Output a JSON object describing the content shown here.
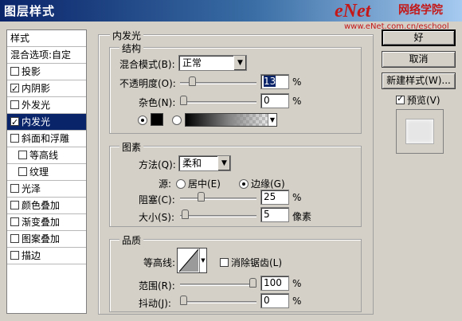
{
  "window": {
    "title": "图层样式",
    "watermark": "eNet",
    "watermark_sub": "网络学院",
    "watermark_url": "www.eNet.com.cn/eschool"
  },
  "styles_panel": {
    "header": "样式",
    "blending": "混合选项:自定",
    "items": [
      {
        "label": "投影",
        "checked": false
      },
      {
        "label": "内阴影",
        "checked": true
      },
      {
        "label": "外发光",
        "checked": false
      },
      {
        "label": "内发光",
        "checked": true,
        "selected": true
      },
      {
        "label": "斜面和浮雕",
        "checked": false
      },
      {
        "label": "等高线",
        "checked": false,
        "indent": true
      },
      {
        "label": "纹理",
        "checked": false,
        "indent": true
      },
      {
        "label": "光泽",
        "checked": false
      },
      {
        "label": "颜色叠加",
        "checked": false
      },
      {
        "label": "渐变叠加",
        "checked": false
      },
      {
        "label": "图案叠加",
        "checked": false
      },
      {
        "label": "描边",
        "checked": false
      }
    ]
  },
  "inner_glow": {
    "title": "内发光",
    "structure": {
      "title": "结构",
      "blend_mode_label": "混合模式(B):",
      "blend_mode_value": "正常",
      "opacity_label": "不透明度(O):",
      "opacity_value": "13",
      "opacity_unit": "%",
      "opacity_fraction": 0.13,
      "noise_label": "杂色(N):",
      "noise_value": "0",
      "noise_unit": "%",
      "noise_fraction": 0.0,
      "color_swatch": "#000000"
    },
    "elements": {
      "title": "图素",
      "technique_label": "方法(Q):",
      "technique_value": "柔和",
      "source_label": "源:",
      "source_center": "居中(E)",
      "source_edge": "边缘(G)",
      "choke_label": "阻塞(C):",
      "choke_value": "25",
      "choke_unit": "%",
      "choke_fraction": 0.25,
      "size_label": "大小(S):",
      "size_value": "5",
      "size_unit": "像素",
      "size_fraction": 0.02
    },
    "quality": {
      "title": "品质",
      "contour_label": "等高线:",
      "antialias_label": "消除锯齿(L)",
      "range_label": "范围(R):",
      "range_value": "100",
      "range_unit": "%",
      "range_fraction": 1.0,
      "jitter_label": "抖动(J):",
      "jitter_value": "0",
      "jitter_unit": "%",
      "jitter_fraction": 0.0
    }
  },
  "buttons": {
    "ok": "好",
    "cancel": "取消",
    "new_style": "新建样式(W)...",
    "preview": "预览(V)",
    "preview_checked": true
  }
}
